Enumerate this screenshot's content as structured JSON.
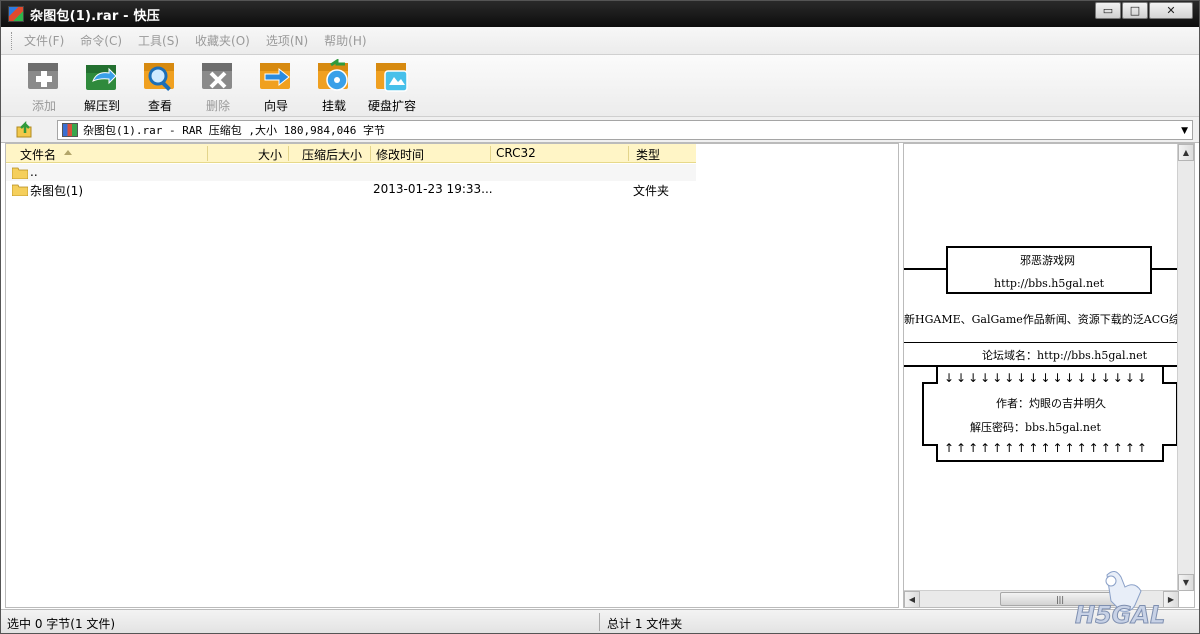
{
  "window": {
    "title": "杂图包(1).rar - 快压",
    "minimize_glyph": "▭",
    "maximize_glyph": "□",
    "close_glyph": "✕"
  },
  "menu": [
    "文件(F)",
    "命令(C)",
    "工具(S)",
    "收藏夹(O)",
    "选项(N)",
    "帮助(H)"
  ],
  "toolbar": {
    "buttons": [
      {
        "label": "添加",
        "icon": "add-icon",
        "enabled": false
      },
      {
        "label": "解压到",
        "icon": "extract-icon",
        "enabled": true
      },
      {
        "label": "查看",
        "icon": "view-icon",
        "enabled": true
      },
      {
        "label": "删除",
        "icon": "delete-icon",
        "enabled": false
      },
      {
        "label": "向导",
        "icon": "wizard-icon",
        "enabled": true
      },
      {
        "label": "挂载",
        "icon": "mount-icon",
        "enabled": true
      },
      {
        "label": "硬盘扩容",
        "icon": "disk-expand-icon",
        "enabled": true
      }
    ]
  },
  "address": {
    "text": "杂图包(1).rar - RAR 压缩包 ,大小 180,984,046 字节"
  },
  "columns": {
    "name": "文件名",
    "size": "大小",
    "packed": "压缩后大小",
    "modified": "修改时间",
    "crc": "CRC32",
    "type": "类型"
  },
  "rows": [
    {
      "name": "..",
      "size": "",
      "packed": "",
      "modified": "",
      "crc": "",
      "type": ""
    },
    {
      "name": "杂图包(1)",
      "size": "",
      "packed": "",
      "modified": "2013-01-23   19:33...",
      "crc": "",
      "type": "文件夹"
    }
  ],
  "preview": {
    "site_name": "邪恶游戏网",
    "site_url": "http://bbs.h5gal.net",
    "intro": "新HGAME、GalGame作品新闻、资源下载的泛ACG综合论",
    "domain_line": "论坛域名：http://bbs.h5gal.net",
    "down_arrows": "↓↓↓↓↓↓↓↓↓↓↓↓↓↓↓↓↓",
    "author": "作者：灼眼の吉井明久",
    "password": "解压密码：bbs.h5gal.net",
    "up_arrows": "↑↑↑↑↑↑↑↑↑↑↑↑↑↑↑↑↑",
    "scroll_up": "▲",
    "scroll_down": "▼",
    "scroll_left": "◀",
    "scroll_right": "▶",
    "thumb_grip": "|||"
  },
  "status": {
    "left": "选中 0 字节(1 文件)",
    "right": "总计 1 文件夹"
  },
  "watermark": {
    "text": "H5GAL"
  }
}
